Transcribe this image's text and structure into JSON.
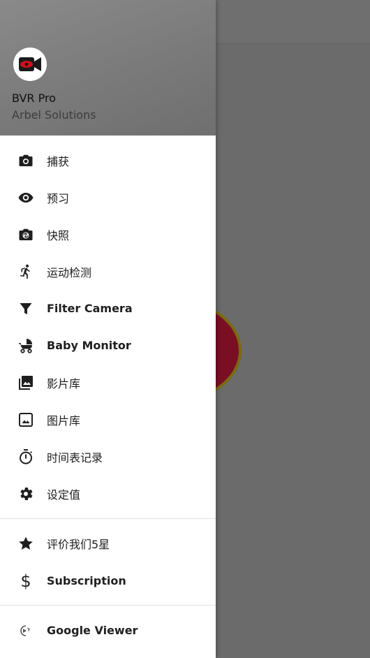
{
  "drawer": {
    "app_name": "BVR Pro",
    "company": "Arbel Solutions",
    "items": [
      {
        "label": "捕获",
        "icon": "camera-icon"
      },
      {
        "label": "预习",
        "icon": "eye-icon"
      },
      {
        "label": "快照",
        "icon": "snapshot-camera-icon"
      },
      {
        "label": "运动检测",
        "icon": "running-person-icon"
      },
      {
        "label": "Filter Camera",
        "icon": "filter-funnel-icon"
      },
      {
        "label": "Baby Monitor",
        "icon": "stroller-icon"
      },
      {
        "label": "影片库",
        "icon": "video-library-icon"
      },
      {
        "label": "图片库",
        "icon": "image-icon"
      },
      {
        "label": "时间表记录",
        "icon": "timer-icon"
      },
      {
        "label": "设定值",
        "icon": "settings-gear-icon"
      }
    ],
    "secondary_items": [
      {
        "label": "评价我们5星",
        "icon": "star-icon"
      },
      {
        "label": "Subscription",
        "icon": "dollar-icon"
      }
    ],
    "tertiary_items": [
      {
        "label": "Google Viewer",
        "icon": "google-viewer-icon"
      }
    ]
  },
  "colors": {
    "accent": "#7a0f24",
    "overlay": "#666666",
    "header": "#7f7f7f"
  }
}
